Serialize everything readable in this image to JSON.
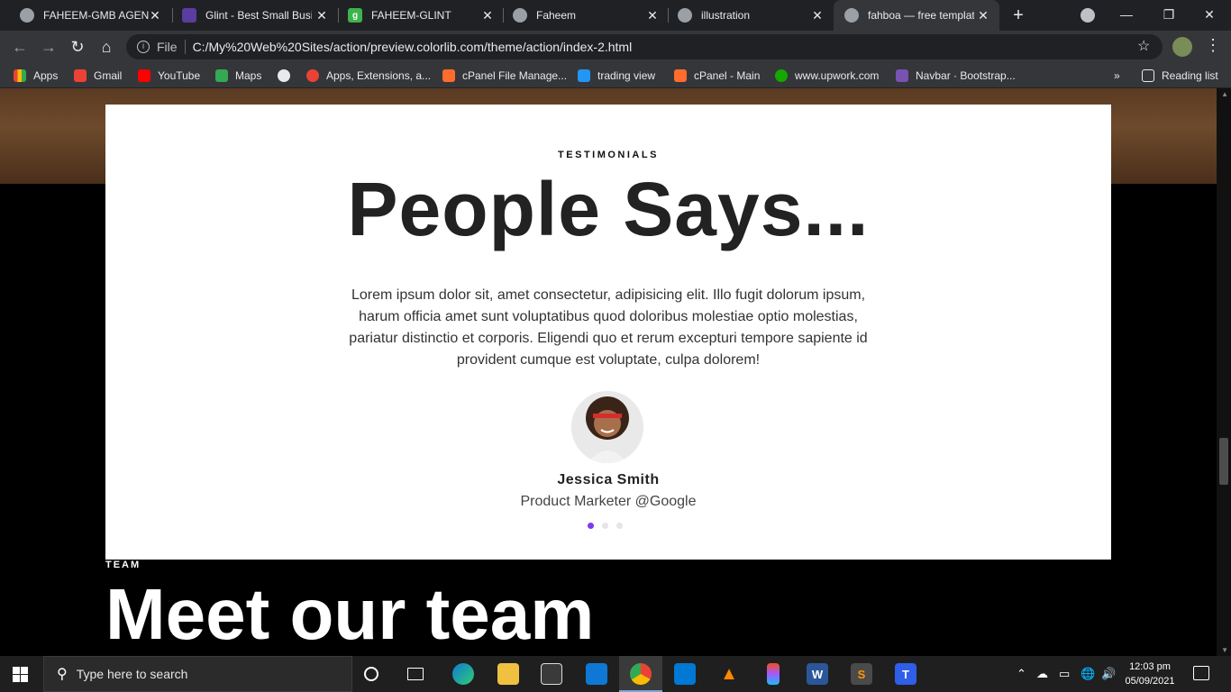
{
  "browser": {
    "tabs": [
      {
        "title": "FAHEEM-GMB AGENC",
        "icon": "globe-icon",
        "active": false
      },
      {
        "title": "Glint - Best Small Busi",
        "icon": "colorlib-icon",
        "active": false
      },
      {
        "title": "FAHEEM-GLINT",
        "icon": "g-logo-icon",
        "active": false
      },
      {
        "title": "Faheem",
        "icon": "globe-icon",
        "active": false
      },
      {
        "title": "illustration",
        "icon": "globe-icon",
        "active": false
      },
      {
        "title": "fahboa — free templat",
        "icon": "globe-icon",
        "active": true
      }
    ],
    "tab_close": "✕",
    "new_tab": "+",
    "address": {
      "label": "File",
      "url": "C:/My%20Web%20Sites/action/preview.colorlib.com/theme/action/index-2.html"
    },
    "bookmarks": [
      {
        "label": "Apps",
        "icon": "apps-grid-icon",
        "color": "#ea4335"
      },
      {
        "label": "Gmail",
        "icon": "gmail-icon",
        "color": "#ea4335"
      },
      {
        "label": "YouTube",
        "icon": "youtube-icon",
        "color": "#ff0000"
      },
      {
        "label": "Maps",
        "icon": "maps-icon",
        "color": "#34a853"
      },
      {
        "label": "",
        "icon": "globe-icon",
        "color": "#e8eaed"
      },
      {
        "label": "Apps, Extensions, a...",
        "icon": "extension-icon",
        "color": "#ea4335"
      },
      {
        "label": "cPanel File Manage...",
        "icon": "cpanel-icon",
        "color": "#ff6c2c"
      },
      {
        "label": "trading view",
        "icon": "tradingview-icon",
        "color": "#2196f3"
      },
      {
        "label": "cPanel - Main",
        "icon": "cpanel-icon",
        "color": "#ff6c2c"
      },
      {
        "label": "www.upwork.com",
        "icon": "upwork-icon",
        "color": "#14a800"
      },
      {
        "label": "Navbar · Bootstrap...",
        "icon": "bootstrap-icon",
        "color": "#7952b3"
      }
    ],
    "more_bookmarks": "»",
    "reading_list": "Reading list"
  },
  "page": {
    "testimonials": {
      "subheading": "TESTIMONIALS",
      "heading": "People Says...",
      "quote": "Lorem ipsum dolor sit, amet consectetur, adipisicing elit. Illo fugit dolorum ipsum, harum officia amet sunt voluptatibus quod doloribus molestiae optio molestias, pariatur distinctio et corporis. Eligendi quo et rerum excepturi tempore sapiente id provident cumque est voluptate, culpa dolorem!",
      "person_name": "Jessica Smith",
      "person_role": "Product Marketer @Google",
      "dots": 3,
      "active_dot": 0,
      "accent": "#7c3aed"
    },
    "team": {
      "subheading": "TEAM",
      "heading": "Meet our team"
    }
  },
  "taskbar": {
    "search_placeholder": "Type here to search",
    "apps": [
      "cortana-icon",
      "task-view-icon",
      "edge-icon",
      "file-explorer-icon",
      "store-icon",
      "mail-icon",
      "chrome-icon",
      "vscode-icon",
      "vlc-icon",
      "figma-icon",
      "word-icon",
      "sublime-icon",
      "typora-icon"
    ],
    "time": "12:03 pm",
    "date": "05/09/2021"
  }
}
